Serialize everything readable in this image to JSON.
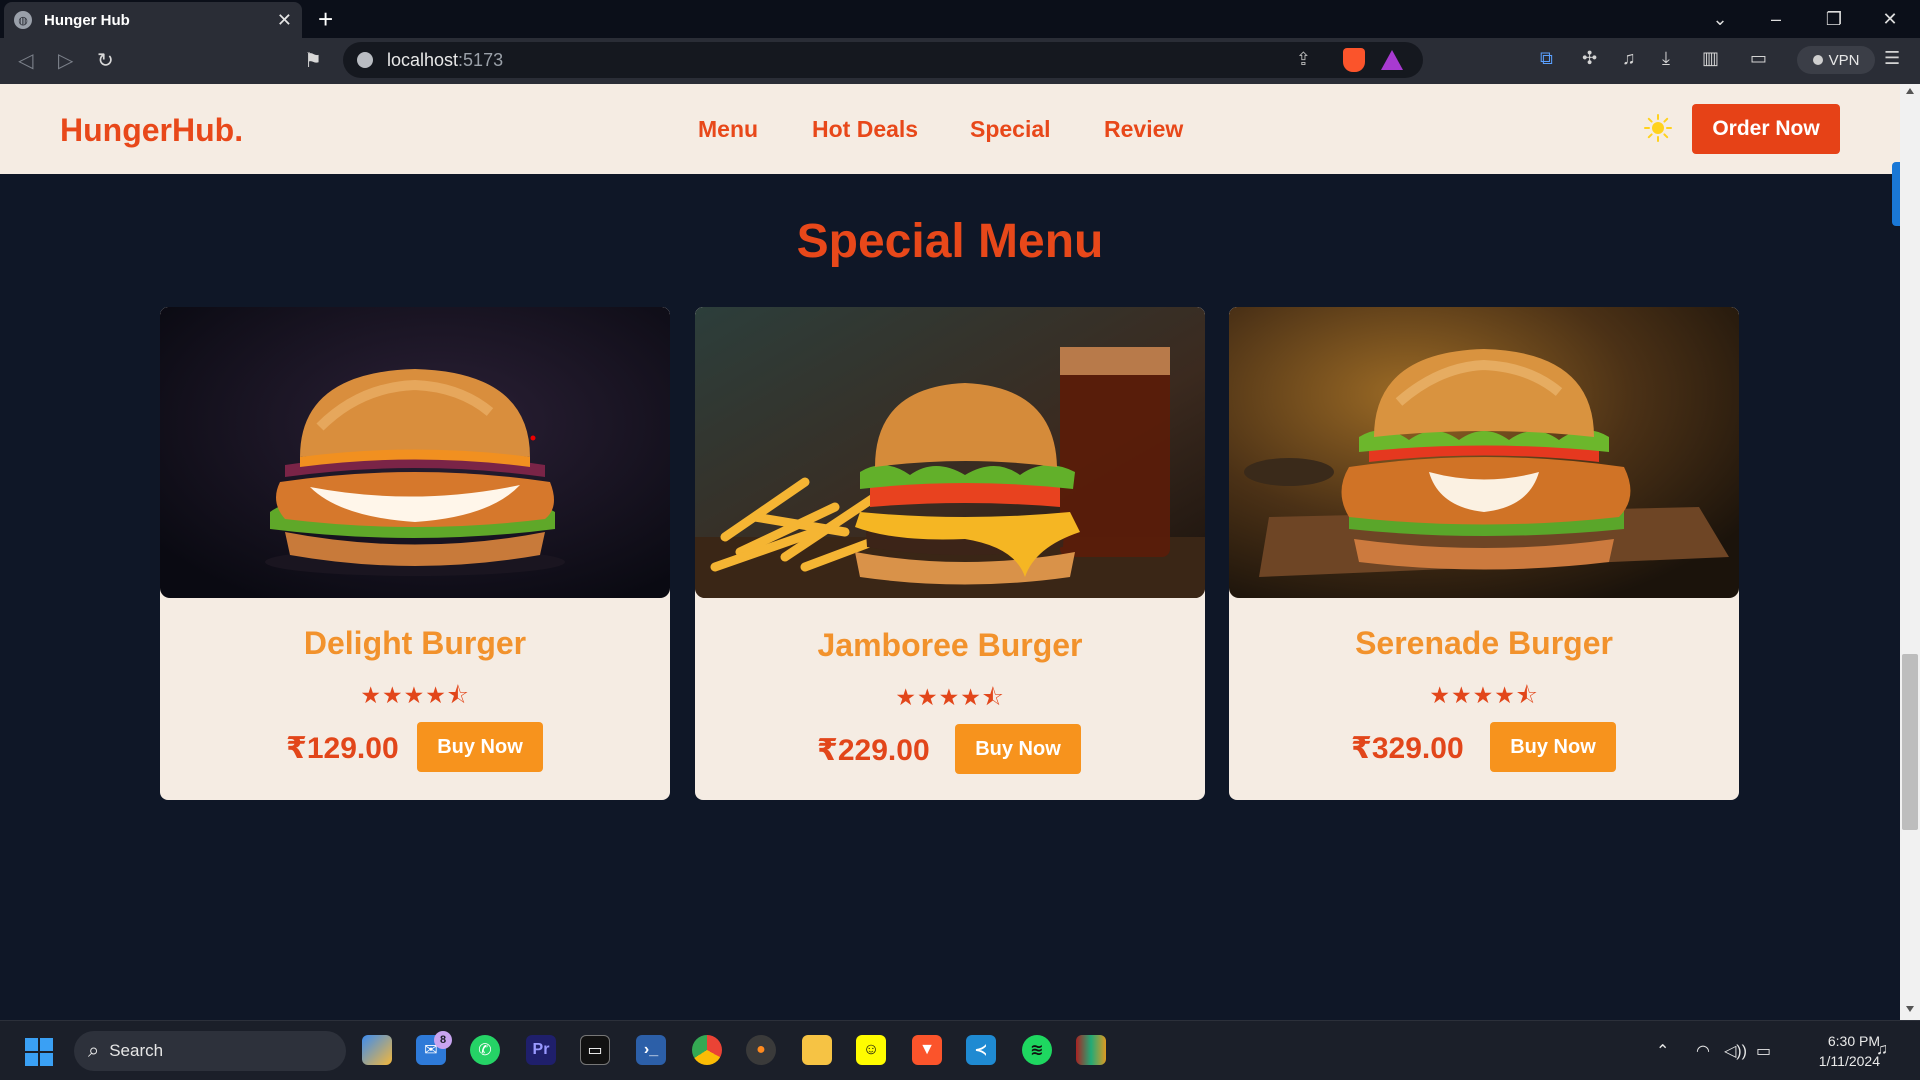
{
  "browser": {
    "tab_title": "Hunger Hub",
    "new_tab_label": "+",
    "url_host": "localhost",
    "url_port": ":5173",
    "vpn_label": "VPN"
  },
  "header": {
    "logo": "HungerHub.",
    "nav": [
      "Menu",
      "Hot Deals",
      "Special",
      "Review"
    ],
    "order_button": "Order Now",
    "theme_icon": "sun-icon"
  },
  "section": {
    "title": "Special Menu"
  },
  "products": [
    {
      "name": "Delight Burger",
      "price": "₹129.00",
      "button": "Buy Now",
      "rating": 4.5,
      "stars": "★★★★⯪"
    },
    {
      "name": "Jamboree Burger",
      "price": "₹229.00",
      "button": "Buy Now",
      "rating": 4.5,
      "stars": "★★★★⯪"
    },
    {
      "name": "Serenade Burger",
      "price": "₹329.00",
      "button": "Buy Now",
      "rating": 4.5,
      "stars": "★★★★⯪"
    }
  ],
  "taskbar": {
    "search_label": "Search",
    "mail_badge": "8",
    "time": "6:30 PM",
    "date": "1/11/2024"
  },
  "colors": {
    "accent": "#e8481a",
    "button_orange": "#f7931d",
    "page_bg": "#0f1727",
    "card_bg": "#f5ece3"
  }
}
